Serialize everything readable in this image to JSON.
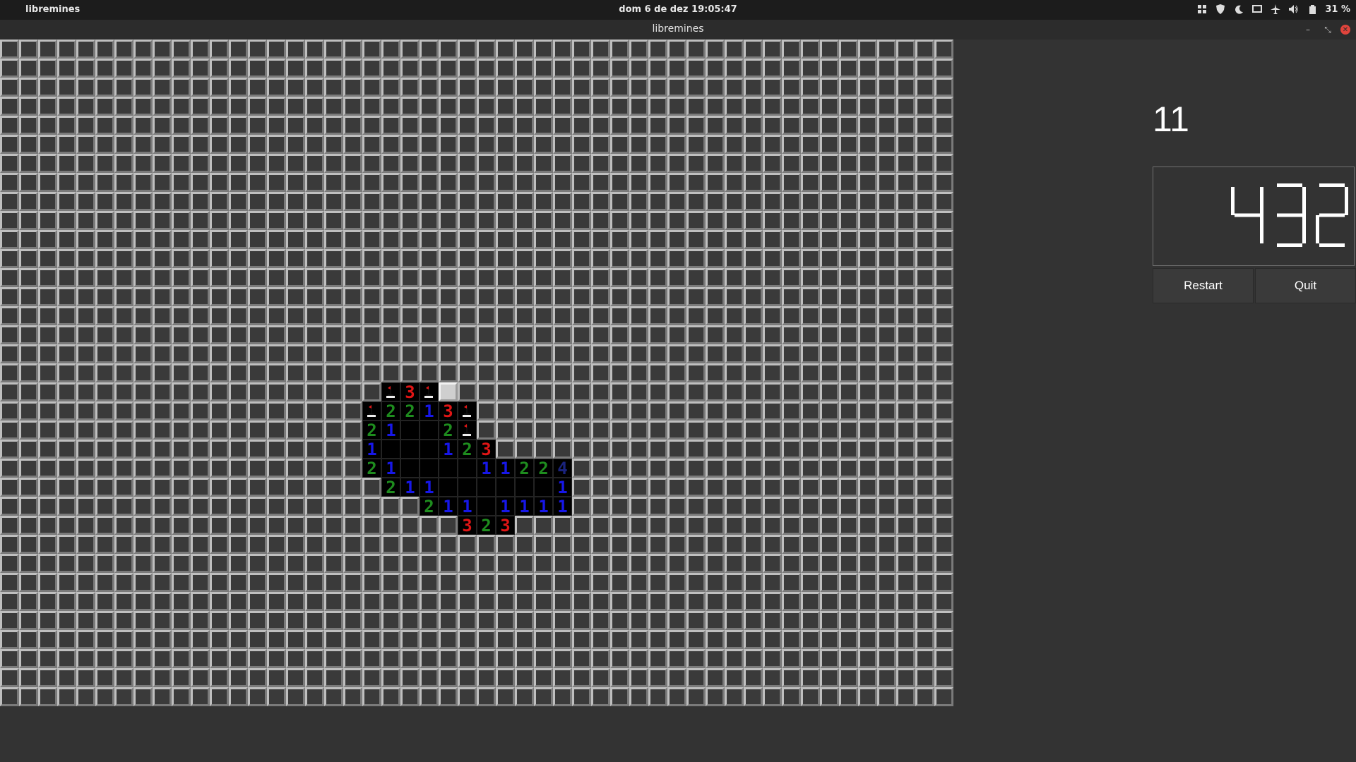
{
  "topbar": {
    "app_name": "libremines",
    "clock": "dom 6 de dez  19:05:47",
    "battery": "31 %",
    "tray_icons": [
      "grid-icon",
      "shield-icon",
      "moon-icon",
      "screen-icon",
      "airplane-icon",
      "volume-icon",
      "battery-icon"
    ]
  },
  "window": {
    "title": "libremines"
  },
  "game": {
    "mines_remaining": "11",
    "timer": "432",
    "columns": 50,
    "rows": 35,
    "number_colors": {
      "1": "#1717e8",
      "2": "#1e8c1e",
      "3": "#e01515"
    },
    "highlighted_cell": [
      18,
      23
    ],
    "flags": [
      [
        18,
        20
      ],
      [
        18,
        22
      ],
      [
        19,
        19
      ],
      [
        19,
        24
      ],
      [
        20,
        24
      ]
    ],
    "open_cells": [
      [
        18,
        21,
        "3"
      ],
      [
        19,
        20,
        "2"
      ],
      [
        19,
        21,
        "2"
      ],
      [
        19,
        22,
        "1"
      ],
      [
        19,
        23,
        "3"
      ],
      [
        20,
        19,
        "2"
      ],
      [
        20,
        20,
        "1"
      ],
      [
        20,
        21,
        ""
      ],
      [
        20,
        22,
        ""
      ],
      [
        20,
        23,
        "2"
      ],
      [
        21,
        19,
        "1"
      ],
      [
        21,
        20,
        ""
      ],
      [
        21,
        21,
        ""
      ],
      [
        21,
        22,
        ""
      ],
      [
        21,
        23,
        "1"
      ],
      [
        21,
        24,
        "2"
      ],
      [
        21,
        25,
        "3"
      ],
      [
        22,
        19,
        "2"
      ],
      [
        22,
        20,
        "1"
      ],
      [
        22,
        21,
        ""
      ],
      [
        22,
        22,
        ""
      ],
      [
        22,
        23,
        ""
      ],
      [
        22,
        24,
        ""
      ],
      [
        22,
        25,
        "1"
      ],
      [
        22,
        26,
        "1"
      ],
      [
        22,
        27,
        "2"
      ],
      [
        22,
        28,
        "2"
      ],
      [
        22,
        29,
        "4"
      ],
      [
        23,
        20,
        "2"
      ],
      [
        23,
        21,
        "1"
      ],
      [
        23,
        22,
        "1"
      ],
      [
        23,
        23,
        ""
      ],
      [
        23,
        24,
        ""
      ],
      [
        23,
        25,
        ""
      ],
      [
        23,
        26,
        ""
      ],
      [
        23,
        27,
        ""
      ],
      [
        23,
        28,
        ""
      ],
      [
        23,
        29,
        "1"
      ],
      [
        24,
        22,
        "2"
      ],
      [
        24,
        23,
        "1"
      ],
      [
        24,
        24,
        "1"
      ],
      [
        24,
        25,
        ""
      ],
      [
        24,
        26,
        "1"
      ],
      [
        24,
        27,
        "1"
      ],
      [
        24,
        28,
        "1"
      ],
      [
        24,
        29,
        "1"
      ],
      [
        25,
        24,
        "3"
      ],
      [
        25,
        25,
        "2"
      ],
      [
        25,
        26,
        "3"
      ]
    ]
  },
  "buttons": {
    "restart": "Restart",
    "quit": "Quit"
  }
}
